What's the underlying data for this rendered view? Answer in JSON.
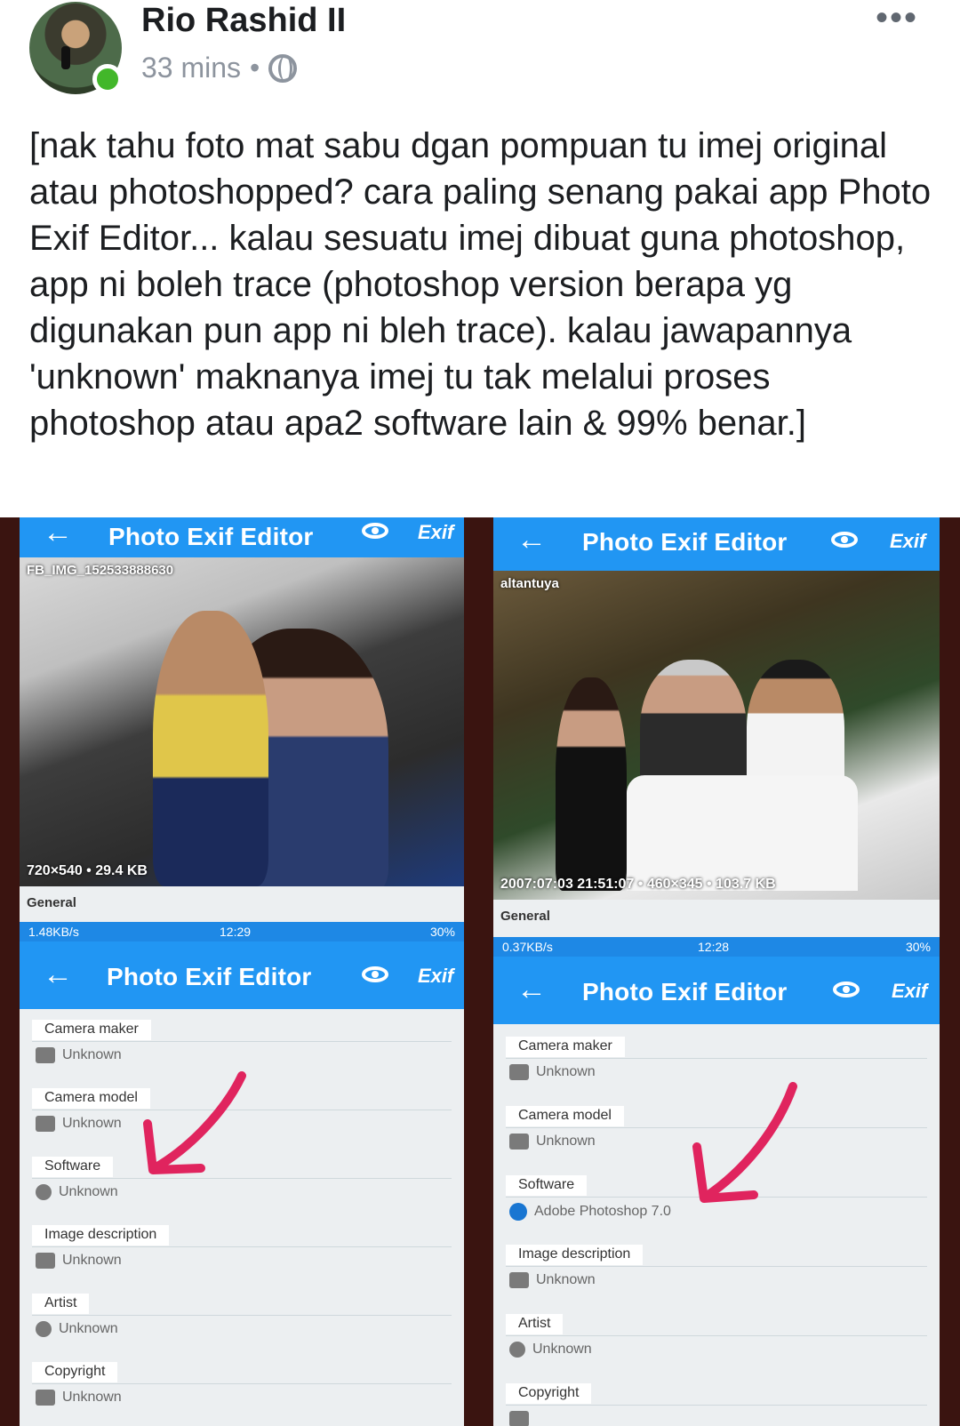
{
  "post": {
    "author": "Rio Rashid II",
    "time": "33 mins",
    "separator": "•",
    "text": "[nak tahu foto mat sabu dgan pompuan tu imej original atau photoshopped? cara paling senang pakai app Photo Exif Editor... kalau sesuatu imej dibuat guna photoshop, app ni boleh trace (photoshop version berapa yg digunakan pun app ni bleh trace). kalau jawapannya 'unknown' maknanya imej tu tak melalui proses photoshop atau apa2 software lain & 99% benar.]",
    "more_icon": "more-horizontal-icon",
    "privacy_icon": "globe-icon"
  },
  "left": {
    "top_title": "Photo Exif Editor",
    "filename": "FB_IMG_152533888630",
    "photo_info": "720×540 • 29.4 KB",
    "general_label": "General",
    "status_left": "1.48KB/s",
    "status_time": "12:29",
    "status_battery": "30%",
    "title": "Photo Exif Editor",
    "exif_label": "Exif",
    "fields": [
      {
        "label": "Camera maker",
        "value": "Unknown"
      },
      {
        "label": "Camera model",
        "value": "Unknown"
      },
      {
        "label": "Software",
        "value": "Unknown"
      },
      {
        "label": "Image description",
        "value": "Unknown"
      },
      {
        "label": "Artist",
        "value": "Unknown"
      },
      {
        "label": "Copyright",
        "value": "Unknown"
      }
    ]
  },
  "right": {
    "top_title": "Photo Exif Editor",
    "exif_label": "Exif",
    "filename": "altantuya",
    "photo_info": "2007:07:03 21:51:07 • 460×345 • 103.7 KB",
    "general_label": "General",
    "status_left": "0.37KB/s",
    "status_time": "12:28",
    "status_battery": "30%",
    "title": "Photo Exif Editor",
    "fields": [
      {
        "label": "Camera maker",
        "value": "Unknown"
      },
      {
        "label": "Camera model",
        "value": "Unknown"
      },
      {
        "label": "Software",
        "value": "Adobe Photoshop 7.0"
      },
      {
        "label": "Image description",
        "value": "Unknown"
      },
      {
        "label": "Artist",
        "value": "Unknown"
      },
      {
        "label": "Copyright",
        "value": ""
      }
    ]
  },
  "colors": {
    "app_bar": "#2196f3",
    "annotation_arrow": "#e0245e",
    "online": "#42b72a"
  }
}
